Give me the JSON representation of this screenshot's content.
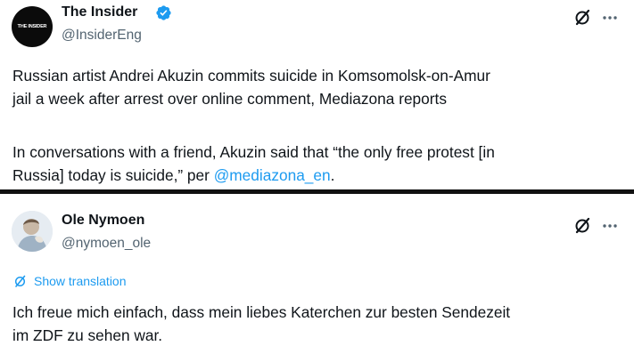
{
  "tweet1": {
    "avatar_text": "THE INSIDER",
    "name": "The Insider",
    "handle": "@InsiderEng",
    "lines": [
      "Russian artist Andrei Akuzin commits suicide in Komsomolsk-on-Amur",
      "jail a week after arrest over online comment, Mediazona reports",
      "In conversations with a friend, Akuzin said that “the only free protest [in",
      "Russia] today is suicide,” per "
    ],
    "mention": "@mediazona_en",
    "after_mention": "."
  },
  "tweet2": {
    "name": "Ole Nymoen",
    "handle": "@nymoen_ole",
    "translate_label": "Show translation",
    "lines": [
      "Ich freue mich einfach, dass mein liebes Katerchen zur besten Sendezeit",
      "im ZDF zu sehen war."
    ]
  },
  "icons": {
    "verified": "verified-badge-icon",
    "grok": "grok-icon",
    "more": "more-icon",
    "translate": "translate-icon"
  },
  "colors": {
    "accent": "#1d9bf0",
    "text": "#0f1419",
    "secondary": "#536471"
  }
}
